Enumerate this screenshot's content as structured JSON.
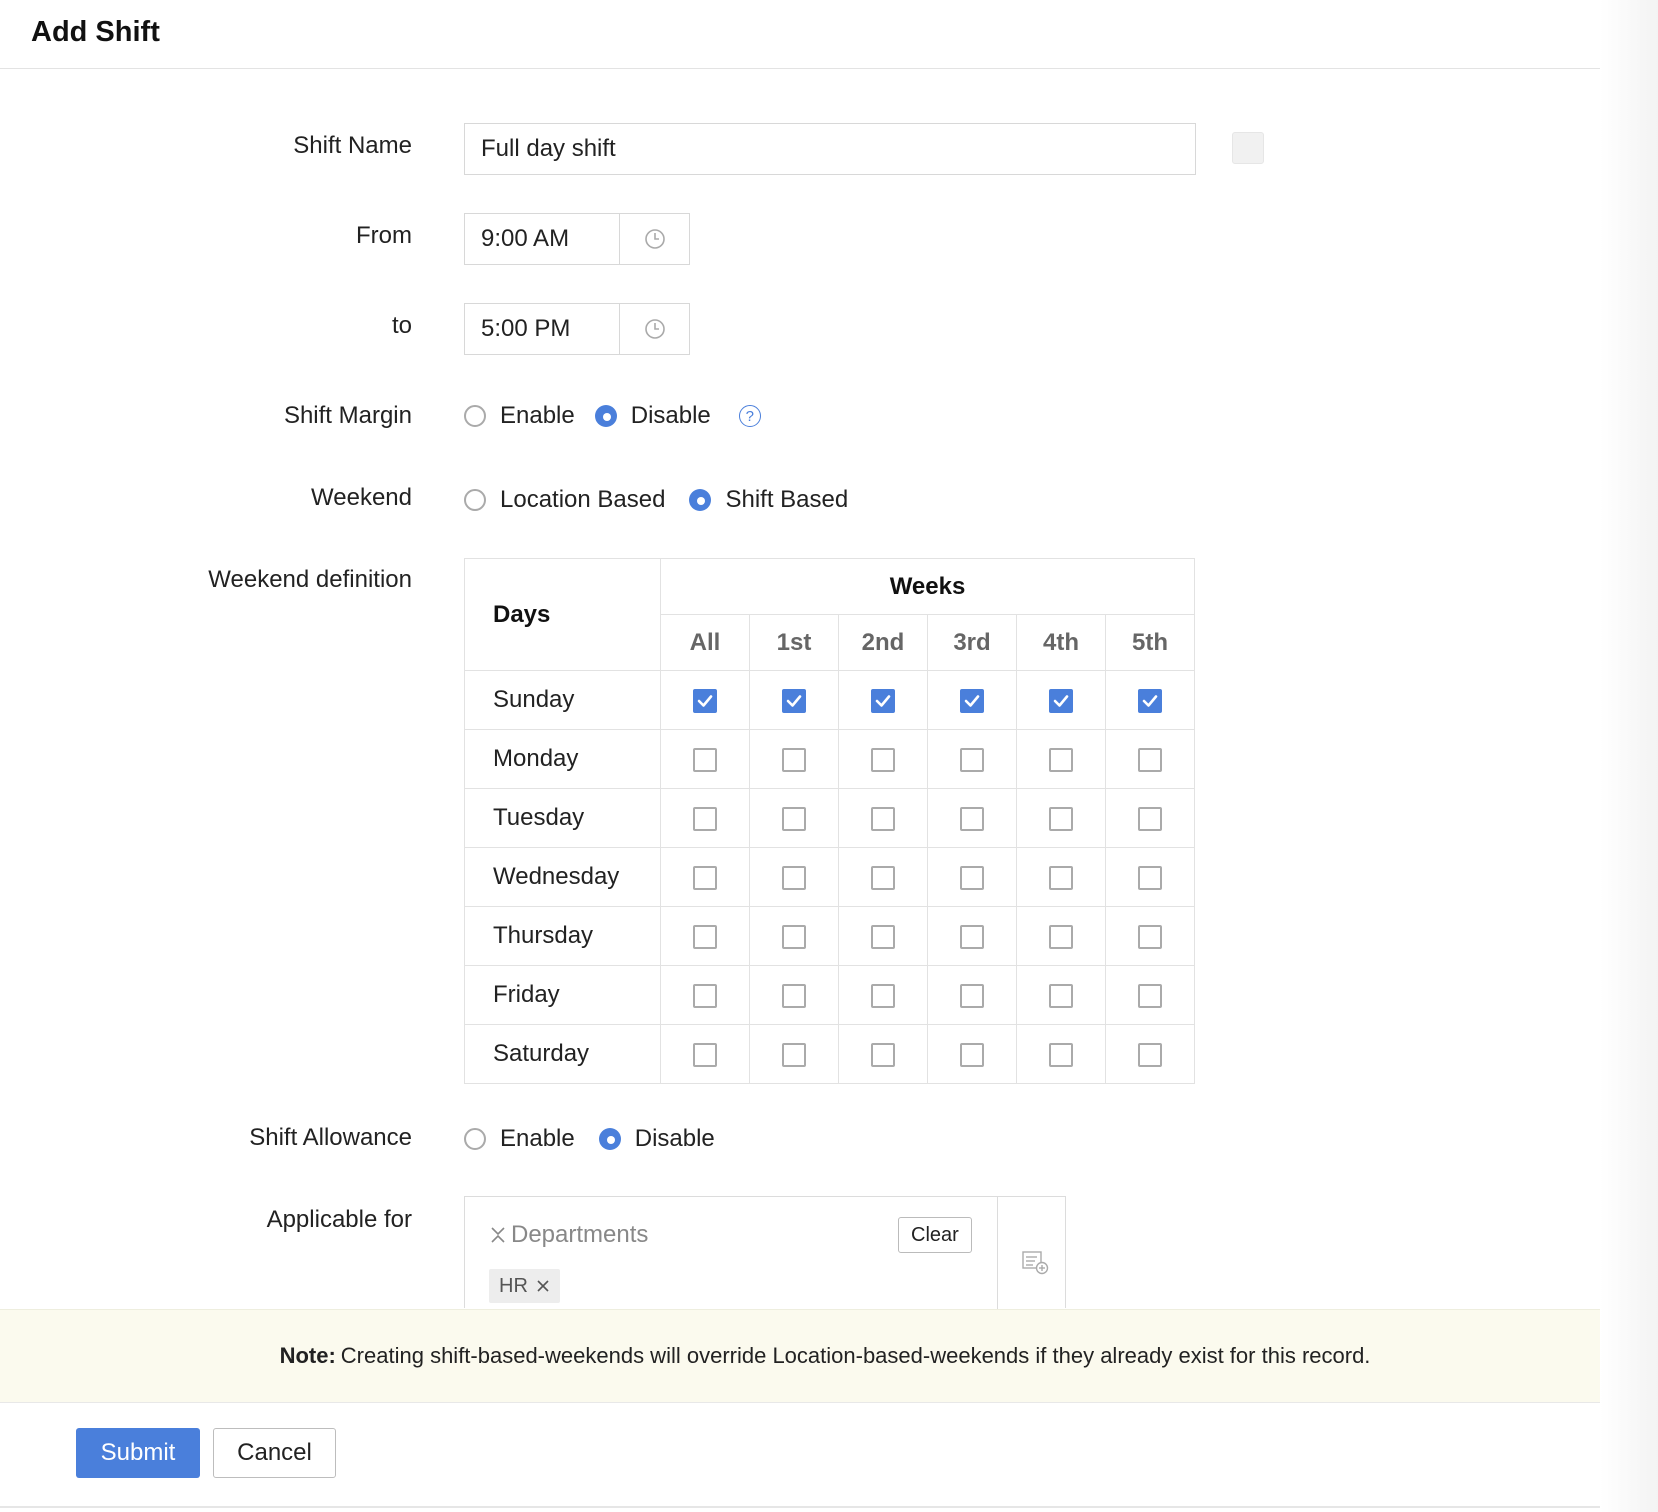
{
  "dialog": {
    "title": "Add Shift"
  },
  "form": {
    "shift_name": {
      "label": "Shift Name",
      "value": "Full day shift"
    },
    "from": {
      "label": "From",
      "value": "9:00 AM"
    },
    "to": {
      "label": "to",
      "value": "5:00 PM"
    },
    "shift_margin": {
      "label": "Shift Margin",
      "options": [
        "Enable",
        "Disable"
      ],
      "selected": "Disable",
      "help": "?"
    },
    "weekend": {
      "label": "Weekend",
      "options": [
        "Location Based",
        "Shift Based"
      ],
      "selected": "Shift Based"
    },
    "weekend_definition": {
      "label": "Weekend definition",
      "days_header": "Days",
      "weeks_header": "Weeks",
      "week_columns": [
        "All",
        "1st",
        "2nd",
        "3rd",
        "4th",
        "5th"
      ],
      "rows": [
        {
          "day": "Sunday",
          "checked": [
            true,
            true,
            true,
            true,
            true,
            true
          ]
        },
        {
          "day": "Monday",
          "checked": [
            false,
            false,
            false,
            false,
            false,
            false
          ]
        },
        {
          "day": "Tuesday",
          "checked": [
            false,
            false,
            false,
            false,
            false,
            false
          ]
        },
        {
          "day": "Wednesday",
          "checked": [
            false,
            false,
            false,
            false,
            false,
            false
          ]
        },
        {
          "day": "Thursday",
          "checked": [
            false,
            false,
            false,
            false,
            false,
            false
          ]
        },
        {
          "day": "Friday",
          "checked": [
            false,
            false,
            false,
            false,
            false,
            false
          ]
        },
        {
          "day": "Saturday",
          "checked": [
            false,
            false,
            false,
            false,
            false,
            false
          ]
        }
      ]
    },
    "shift_allowance": {
      "label": "Shift Allowance",
      "options": [
        "Enable",
        "Disable"
      ],
      "selected": "Disable"
    },
    "applicable_for": {
      "label": "Applicable for",
      "category": "Departments",
      "clear_label": "Clear",
      "chips": [
        "HR"
      ]
    }
  },
  "note": {
    "prefix": "Note:",
    "text": "Creating shift-based-weekends will override Location-based-weekends if they already exist for this record."
  },
  "actions": {
    "submit_label": "Submit",
    "cancel_label": "Cancel"
  },
  "colors": {
    "accent": "#4a7fdb",
    "close": "#d9534f",
    "note_bg": "#fbfaee"
  },
  "icons": {
    "close": "close-icon",
    "clock": "clock-icon",
    "help": "help-icon",
    "list_add": "list-add-icon",
    "chip_remove": "x-icon"
  }
}
